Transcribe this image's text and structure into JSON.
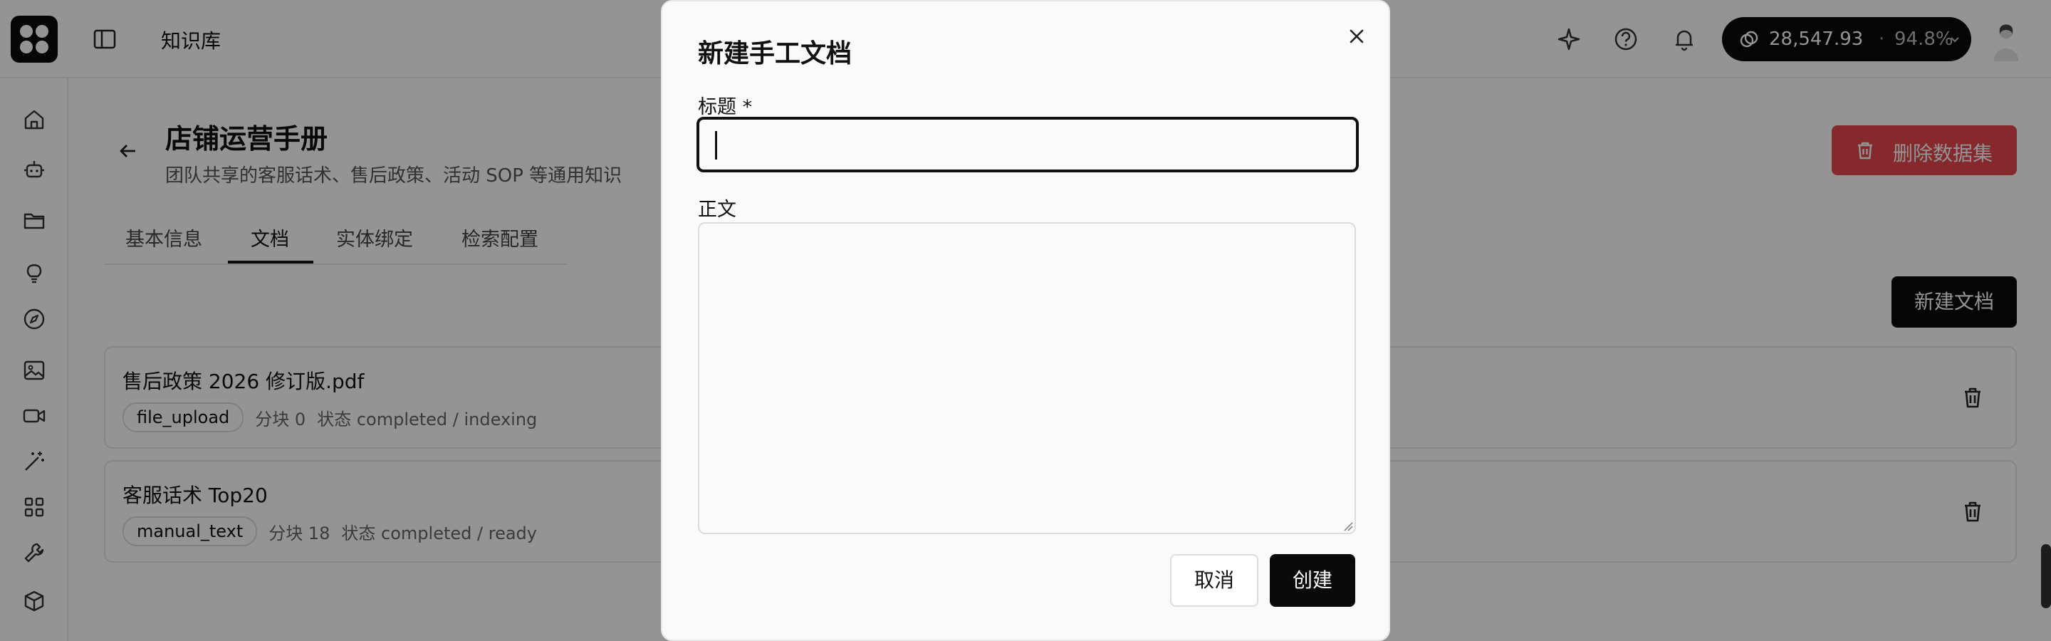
{
  "app": {
    "title": "知识库",
    "balance_amount": "28,547.93",
    "balance_separator": "·",
    "balance_percent": "94.8%"
  },
  "nav_icons": [
    "home-icon",
    "robot-icon",
    "folder-icon",
    "lightbulb-icon",
    "compass-icon",
    "image-icon",
    "video-icon",
    "magic-wand-icon",
    "apps-grid-icon",
    "wrench-icon",
    "box-icon"
  ],
  "header_icons": [
    "sparkle-icon",
    "help-icon",
    "bell-icon"
  ],
  "dataset": {
    "title": "店铺运营手册",
    "description": "团队共享的客服话术、售后政策、活动 SOP 等通用知识",
    "delete_label": "删除数据集"
  },
  "tabs": [
    {
      "label": "基本信息",
      "active": false
    },
    {
      "label": "文档",
      "active": true
    },
    {
      "label": "实体绑定",
      "active": false
    },
    {
      "label": "检索配置",
      "active": false
    }
  ],
  "new_doc_label": "新建文档",
  "documents": [
    {
      "name": "售后政策 2026 修订版.pdf",
      "source": "file_upload",
      "chunks": "分块 0",
      "status": "状态 completed / indexing"
    },
    {
      "name": "客服话术 Top20",
      "source": "manual_text",
      "chunks": "分块 18",
      "status": "状态 completed / ready"
    }
  ],
  "modal": {
    "title": "新建手工文档",
    "title_label": "标题 *",
    "title_value": "",
    "body_label": "正文",
    "body_value": "",
    "cancel_label": "取消",
    "create_label": "创建"
  },
  "colors": {
    "danger": "#e5484d",
    "primary": "#0a0a0a",
    "overlay": "rgba(0,0,0,0.42)"
  }
}
